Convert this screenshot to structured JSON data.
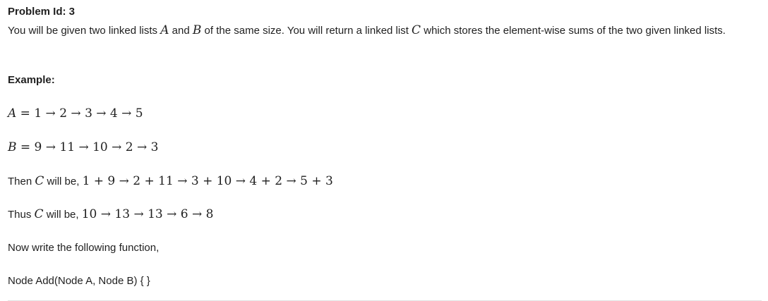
{
  "problem": {
    "title": "Problem Id: 3",
    "desc_before_a": "You will be given two linked lists ",
    "var_a": "A",
    "desc_and": " and ",
    "var_b": "B",
    "desc_middle": " of the same size. You will return a linked list ",
    "var_c": "C",
    "desc_after_c": " which stores the element-wise sums of the two given linked lists."
  },
  "example": {
    "label": "Example:",
    "line_a_var": "A",
    "line_a_expr": " = 1 → 2 → 3 → 4 → 5",
    "line_b_var": "B",
    "line_b_expr": " = 9 → 11 → 10 → 2 → 3",
    "line_c_prefix": "Then ",
    "line_c_var": "C",
    "line_c_mid": " will be, ",
    "line_c_expr": "1 + 9 → 2 + 11 → 3 + 10 → 4 + 2 → 5 + 3",
    "line_d_prefix": "Thus ",
    "line_d_var": "C",
    "line_d_mid": " will be, ",
    "line_d_expr": "10 → 13 → 13 → 6 → 8",
    "instruction": "Now write the following function,",
    "signature": "Node Add(Node A, Node B) { }"
  }
}
